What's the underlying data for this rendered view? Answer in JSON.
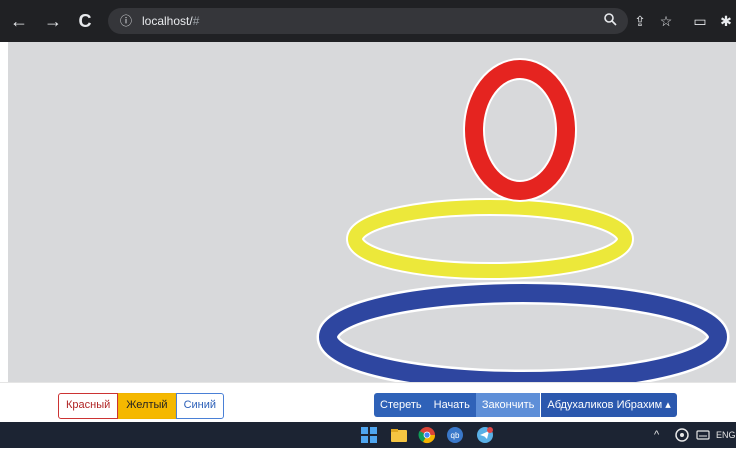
{
  "browser": {
    "url_host": "localhost/",
    "url_hash": "#",
    "icons": {
      "back": "←",
      "forward": "→",
      "reload": "C",
      "info": "ⓘ",
      "search": "🔍",
      "share": "⇪",
      "bookmark": "☆",
      "cast": "▭",
      "extensions": "✱"
    }
  },
  "canvas": {
    "background": "#d8d9db",
    "rings": [
      {
        "name": "red-ring",
        "color": "#e52420"
      },
      {
        "name": "yellow-ring",
        "color": "#ece83a"
      },
      {
        "name": "blue-ring",
        "color": "#2e46a0"
      }
    ]
  },
  "colors": {
    "red_label": "Красный",
    "yellow_label": "Желтый",
    "blue_label": "Синий",
    "selected": "yellow"
  },
  "actions": {
    "clear_label": "Стереть",
    "start_label": "Начать",
    "finish_label": "Закончить",
    "user_label": "Абдуxаликов Ибрахим",
    "user_caret": "▴"
  },
  "taskbar": {
    "language": "ENG",
    "tray_caret": "^",
    "icons": [
      "windows-start-icon",
      "file-explorer-icon",
      "chrome-icon",
      "qbittorrent-icon",
      "telegram-icon"
    ]
  }
}
